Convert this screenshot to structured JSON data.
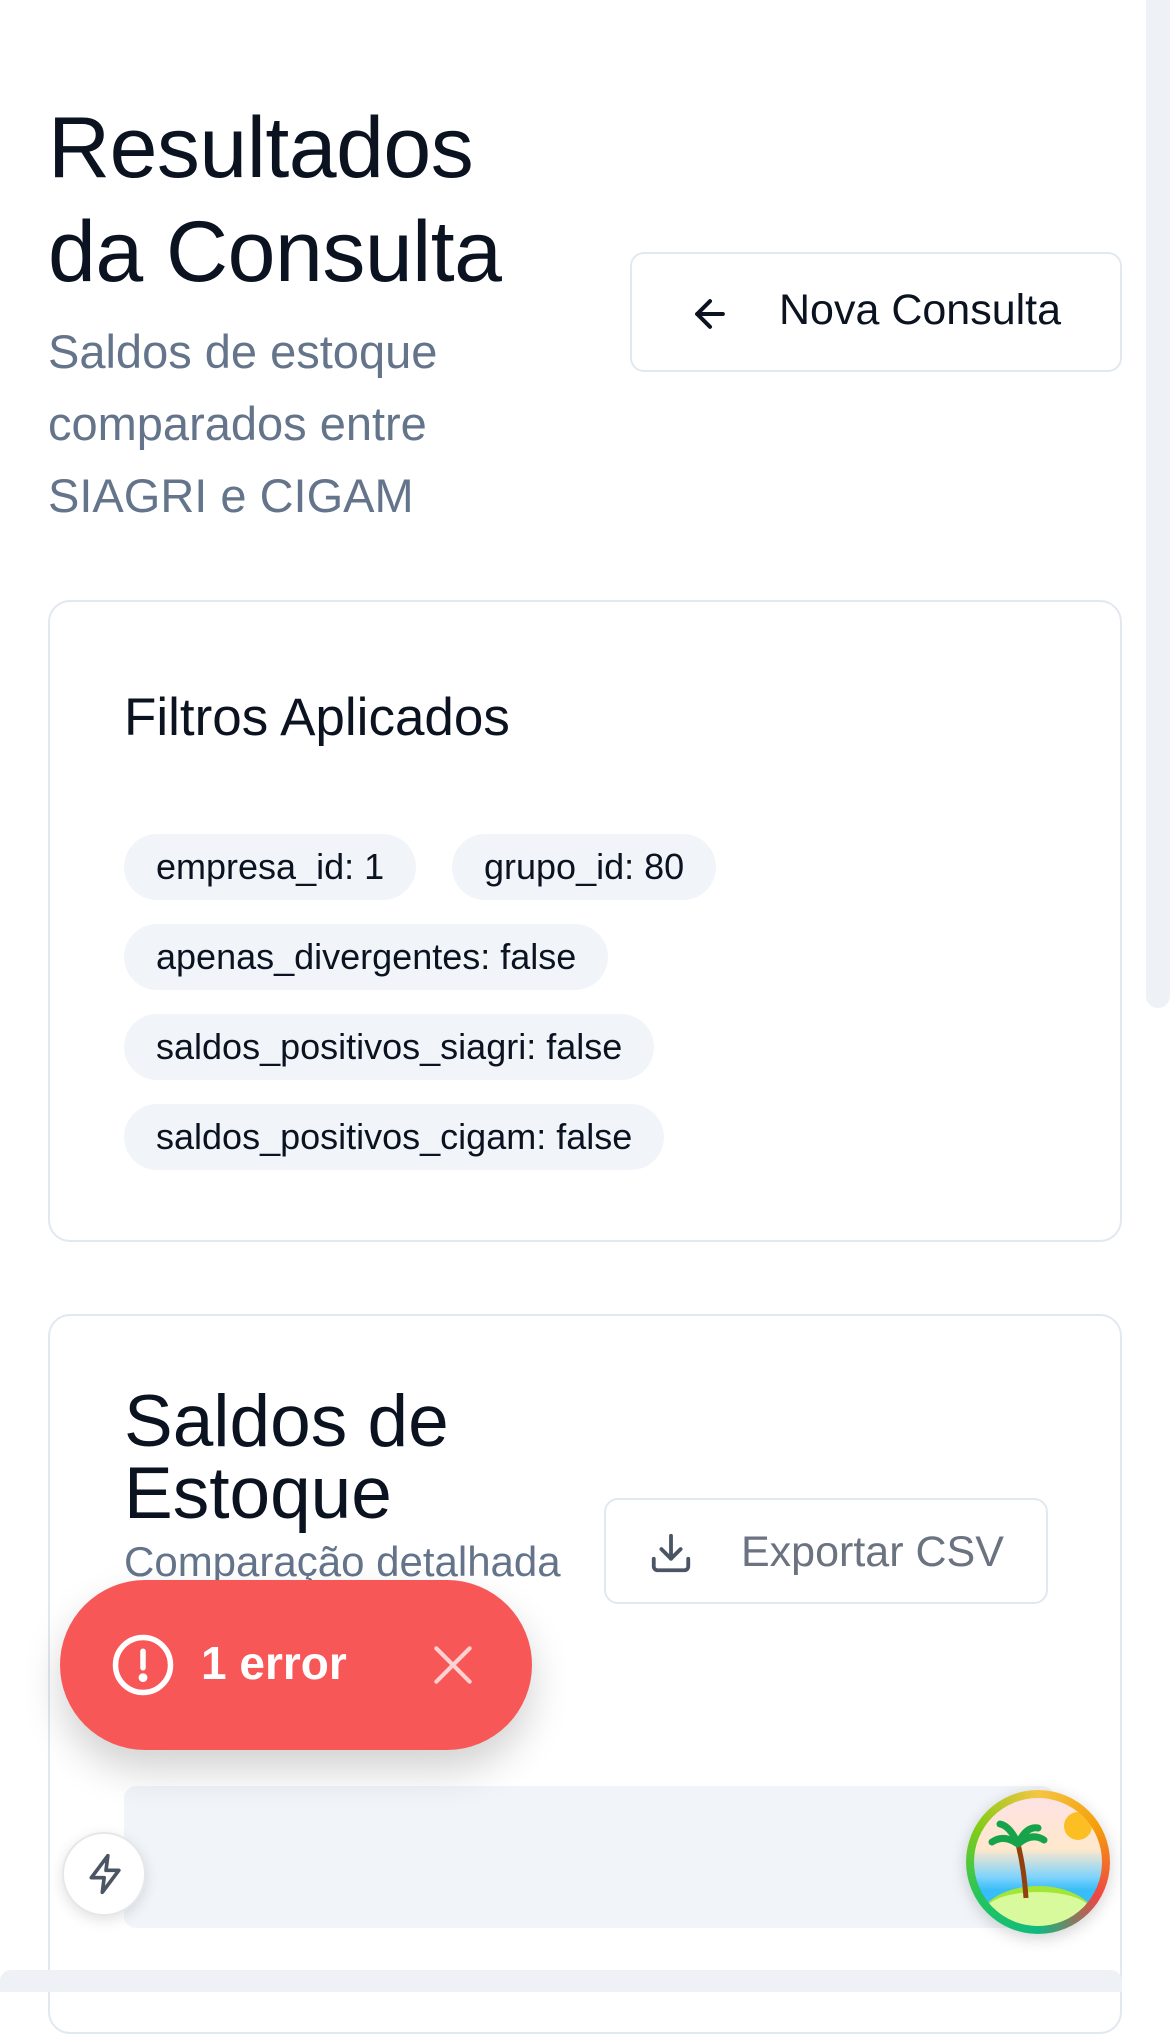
{
  "header": {
    "title": "Resultados da Consulta",
    "subtitle": "Saldos de estoque comparados entre SIAGRI e CIGAM",
    "new_query_button": "Nova Consulta"
  },
  "filters": {
    "title": "Filtros Aplicados",
    "chips": [
      "empresa_id: 1",
      "grupo_id: 80",
      "apenas_divergentes: false",
      "saldos_positivos_siagri: false",
      "saldos_positivos_cigam: false"
    ]
  },
  "stock": {
    "title": "Saldos de Estoque",
    "subtitle": "Comparação detalhada",
    "export_button": "Exportar CSV"
  },
  "error_toast": {
    "label": "1 error",
    "color": "#f85757"
  },
  "icons": {
    "back": "arrow-left-icon",
    "export": "download-icon",
    "error": "alert-circle-icon",
    "close": "close-icon",
    "bolt": "lightning-bolt-icon"
  }
}
